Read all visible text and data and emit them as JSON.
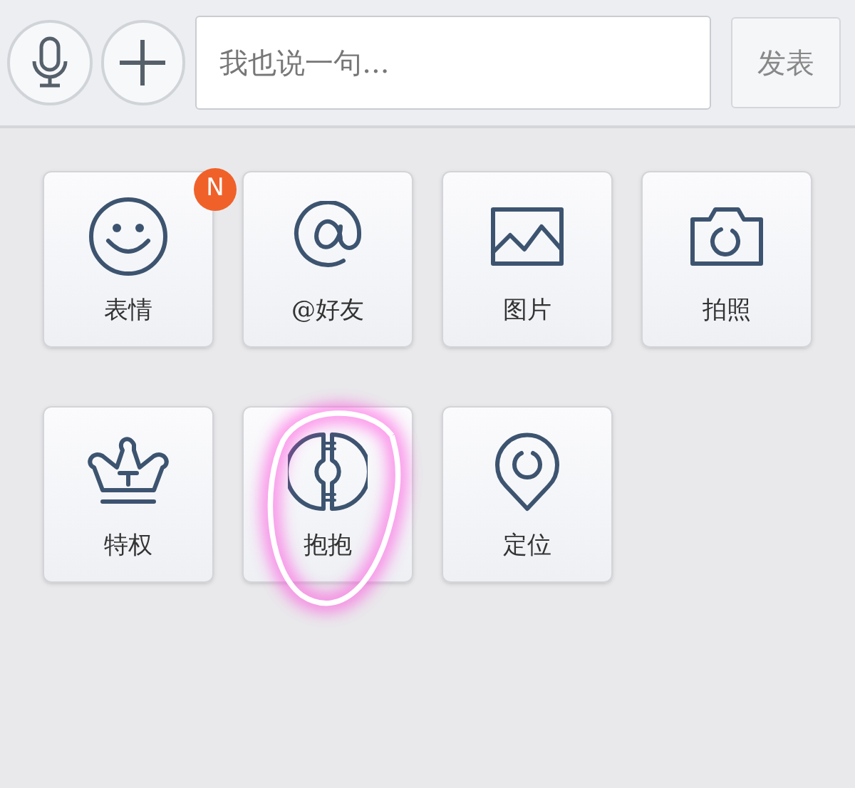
{
  "input_bar": {
    "placeholder": "我也说一句...",
    "send_button": "发表"
  },
  "items": [
    {
      "kind": "smiley",
      "label": "表情",
      "badge": "N",
      "circled": false
    },
    {
      "kind": "at",
      "label": "@好友",
      "circled": false
    },
    {
      "kind": "image",
      "label": "图片",
      "circled": false
    },
    {
      "kind": "camera",
      "label": "拍照",
      "circled": false
    },
    {
      "kind": "crown",
      "label": "特权",
      "circled": false
    },
    {
      "kind": "hug",
      "label": "抱抱",
      "circled": true
    },
    {
      "kind": "location",
      "label": "定位",
      "circled": false
    }
  ]
}
